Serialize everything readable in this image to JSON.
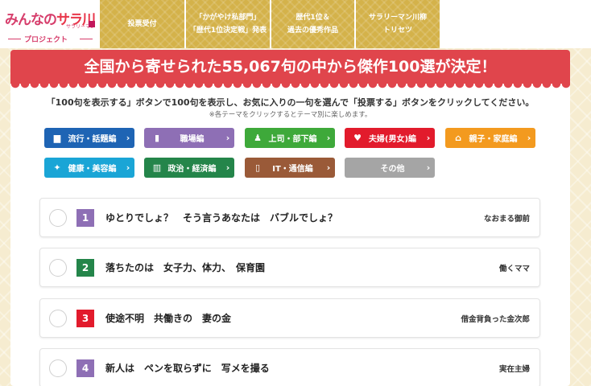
{
  "logo": {
    "title_a": "みんなの",
    "title_b": "サラ川",
    "ruby": "サラリーマン",
    "subtitle": "プロジェクト"
  },
  "nav": [
    {
      "label": "投票受付"
    },
    {
      "label": "「かがやけ私部門」\n「歴代1位決定戦」発表"
    },
    {
      "label": "歴代1位＆\n過去の優秀作品"
    },
    {
      "label": "サラリーマン川柳\nトリセツ"
    }
  ],
  "banner": "全国から寄せられた55,067句の中から傑作100選が決定！",
  "instruction": "「100句を表示する」ボタンで100句を表示し、お気に入りの一句を選んで「投票する」ボタンをクリックしてください。",
  "note": "※各テーマをクリックするとテーマ別に楽しめます。",
  "categories": [
    {
      "label": "流行・話題編",
      "icon": "speech-bubble-icon",
      "glyph": "▆",
      "color": "#1e64b4"
    },
    {
      "label": "職場編",
      "icon": "building-icon",
      "glyph": "▮",
      "color": "#8e6fb5"
    },
    {
      "label": "上司・部下編",
      "icon": "people-icon",
      "glyph": "♟",
      "color": "#3ea93a"
    },
    {
      "label": "夫婦(男女)編",
      "icon": "couple-icon",
      "glyph": "♥",
      "color": "#e21b2c"
    },
    {
      "label": "親子・家庭編",
      "icon": "house-icon",
      "glyph": "⌂",
      "color": "#f39a1f"
    },
    {
      "label": "健康・美容編",
      "icon": "sparkle-icon",
      "glyph": "✦",
      "color": "#1aa5d6"
    },
    {
      "label": "政治・経済編",
      "icon": "chart-icon",
      "glyph": "▥",
      "color": "#24854a"
    },
    {
      "label": "IT・通信編",
      "icon": "phone-icon",
      "glyph": "▯",
      "color": "#9a5a38"
    },
    {
      "label": "その他",
      "icon": "none",
      "glyph": "",
      "color": "#a5a5a5"
    }
  ],
  "entries": [
    {
      "num": "1",
      "text": "ゆとりでしょ？　そう言うあなたは　バブルでしょ？",
      "author": "なおまる御前",
      "color": "#8e6fb5"
    },
    {
      "num": "2",
      "text": "落ちたのは　女子力、体力、　保育園",
      "author": "働くママ",
      "color": "#24854a"
    },
    {
      "num": "3",
      "text": "使途不明　共働きの　妻の金",
      "author": "借金背負った金次郎",
      "color": "#e21b2c"
    },
    {
      "num": "4",
      "text": "新人は　ペンを取らずに　写メを撮る",
      "author": "実在主婦",
      "color": "#8e6fb5"
    }
  ]
}
